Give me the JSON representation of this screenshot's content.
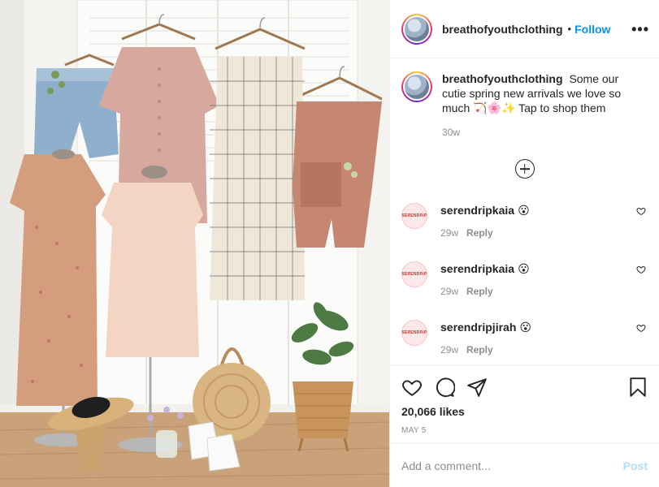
{
  "post": {
    "username": "breathofyouthclothing",
    "dot": "•",
    "follow_label": "Follow",
    "more_label": "•••",
    "photo_alt": "Spring clothing arrivals hanging on white louvered doors",
    "caption": {
      "username": "breathofyouthclothing",
      "text_1": "Some our cutie spring new arrivals we love so much",
      "emojis": "🏹🌸✨",
      "text_2": "Tap to shop them",
      "time": "30w"
    },
    "comments": [
      {
        "avatar_text": "SERENDRIP",
        "username": "serendripkaia",
        "text": "😮",
        "time": "29w",
        "reply_label": "Reply"
      },
      {
        "avatar_text": "SERENDRIP",
        "username": "serendripkaia",
        "text": "😮",
        "time": "29w",
        "reply_label": "Reply"
      },
      {
        "avatar_text": "SERENDRIP",
        "username": "serendripjirah",
        "text": "😮",
        "time": "29w",
        "reply_label": "Reply"
      }
    ],
    "likes": "20,066 likes",
    "date": "MAY 5",
    "add_comment_placeholder": "Add a comment...",
    "post_label": "Post"
  },
  "colors": {
    "accent": "#0095f6",
    "post_disabled": "#b2dffc",
    "muted": "#8e8e8e",
    "text": "#262626"
  },
  "icons": [
    "heart-icon",
    "comment-icon",
    "share-icon",
    "bookmark-icon",
    "plus-circle-icon",
    "more-icon"
  ]
}
